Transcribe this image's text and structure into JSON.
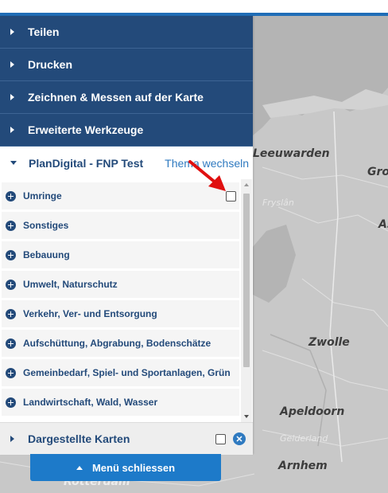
{
  "menu": {
    "items": [
      {
        "label": "Teilen"
      },
      {
        "label": "Drucken"
      },
      {
        "label": "Zeichnen & Messen auf der Karte"
      },
      {
        "label": "Erweiterte Werkzeuge"
      }
    ],
    "theme": {
      "title": "PlanDigital - FNP Test",
      "switch_label": "Thema wechseln"
    },
    "layers": [
      {
        "label": "Umringe",
        "checked": false
      },
      {
        "label": "Sonstiges"
      },
      {
        "label": "Bebauung"
      },
      {
        "label": "Umwelt, Naturschutz"
      },
      {
        "label": "Verkehr, Ver- und Entsorgung"
      },
      {
        "label": "Aufschüttung, Abgrabung, Bodenschätze"
      },
      {
        "label": "Gemeinbedarf, Spiel- und Sportanlagen, Grün"
      },
      {
        "label": "Landwirtschaft, Wald, Wasser"
      }
    ],
    "maps_section": {
      "label": "Dargestellte Karten",
      "close_glyph": "✕"
    },
    "close_menu_label": "Menü schliessen"
  },
  "map": {
    "cities": [
      "Leeuwarden",
      "Gro",
      "As",
      "Zwolle",
      "Apeldoorn",
      "Arnhem",
      "Rotterdam"
    ],
    "regions": [
      "Fryslân",
      "Gelderland"
    ]
  },
  "colors": {
    "panel_dark": "#234a7a",
    "accent": "#2f7ac0",
    "button": "#1d7ac9",
    "annotation_arrow": "#e01010"
  }
}
